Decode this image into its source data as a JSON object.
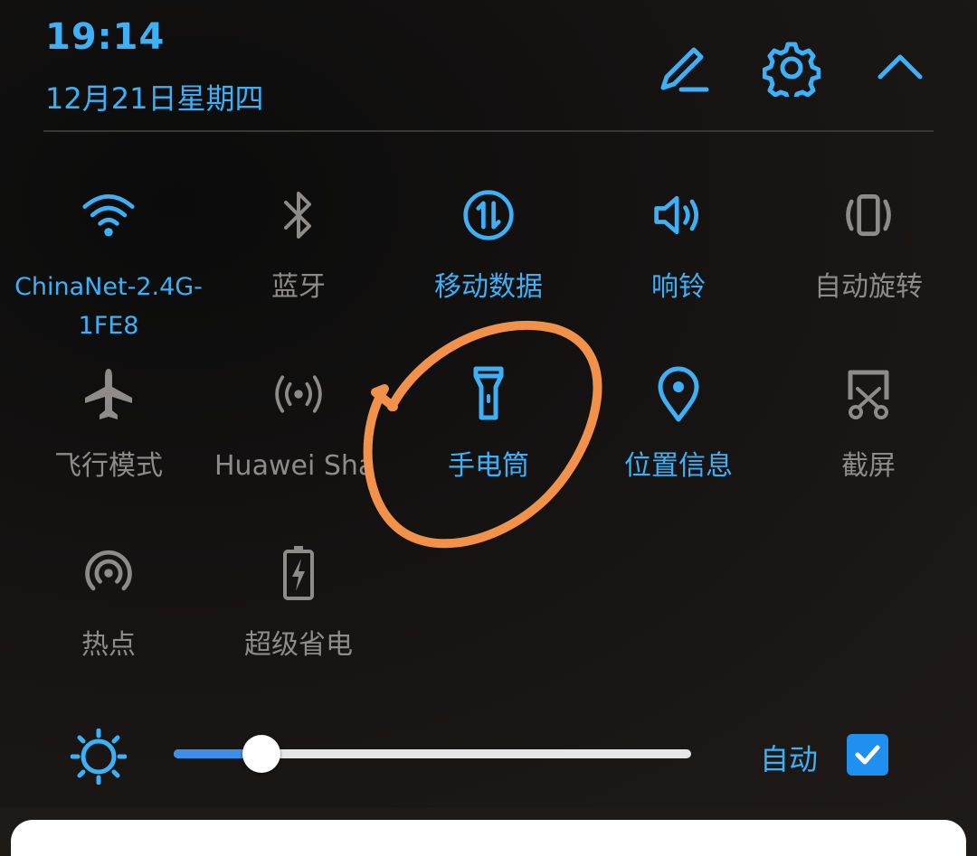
{
  "status": {
    "time": "19:14",
    "date": "12月21日星期四"
  },
  "header_actions": [
    "edit-icon",
    "settings-icon",
    "collapse-icon"
  ],
  "tiles": [
    {
      "key": "wifi",
      "label": "ChinaNet-2.4G-1FE8",
      "icon": "wifi-icon",
      "active": true
    },
    {
      "key": "bluetooth",
      "label": "蓝牙",
      "icon": "bluetooth-icon",
      "active": false
    },
    {
      "key": "mobile-data",
      "label": "移动数据",
      "icon": "mobile-data-icon",
      "active": true
    },
    {
      "key": "sound",
      "label": "响铃",
      "icon": "speaker-icon",
      "active": true
    },
    {
      "key": "auto-rotate",
      "label": "自动旋转",
      "icon": "rotate-icon",
      "active": false
    },
    {
      "key": "airplane",
      "label": "飞行模式",
      "icon": "airplane-icon",
      "active": false
    },
    {
      "key": "huawei-share",
      "label": "Huawei Shar",
      "icon": "share-icon",
      "active": false
    },
    {
      "key": "flashlight",
      "label": "手电筒",
      "icon": "flashlight-icon",
      "active": true
    },
    {
      "key": "location",
      "label": "位置信息",
      "icon": "location-pin-icon",
      "active": true
    },
    {
      "key": "screenshot",
      "label": "截屏",
      "icon": "screenshot-icon",
      "active": false
    },
    {
      "key": "hotspot",
      "label": "热点",
      "icon": "hotspot-icon",
      "active": false
    },
    {
      "key": "power-saving",
      "label": "超级省电",
      "icon": "battery-icon",
      "active": false
    }
  ],
  "brightness": {
    "level": 0.17,
    "auto_label": "自动",
    "auto_checked": true
  },
  "colors": {
    "accent": "#3db0f7",
    "inactive": "#8e8b89",
    "annotation": "#f2924a",
    "slider_fill": "#3b8fe9"
  }
}
